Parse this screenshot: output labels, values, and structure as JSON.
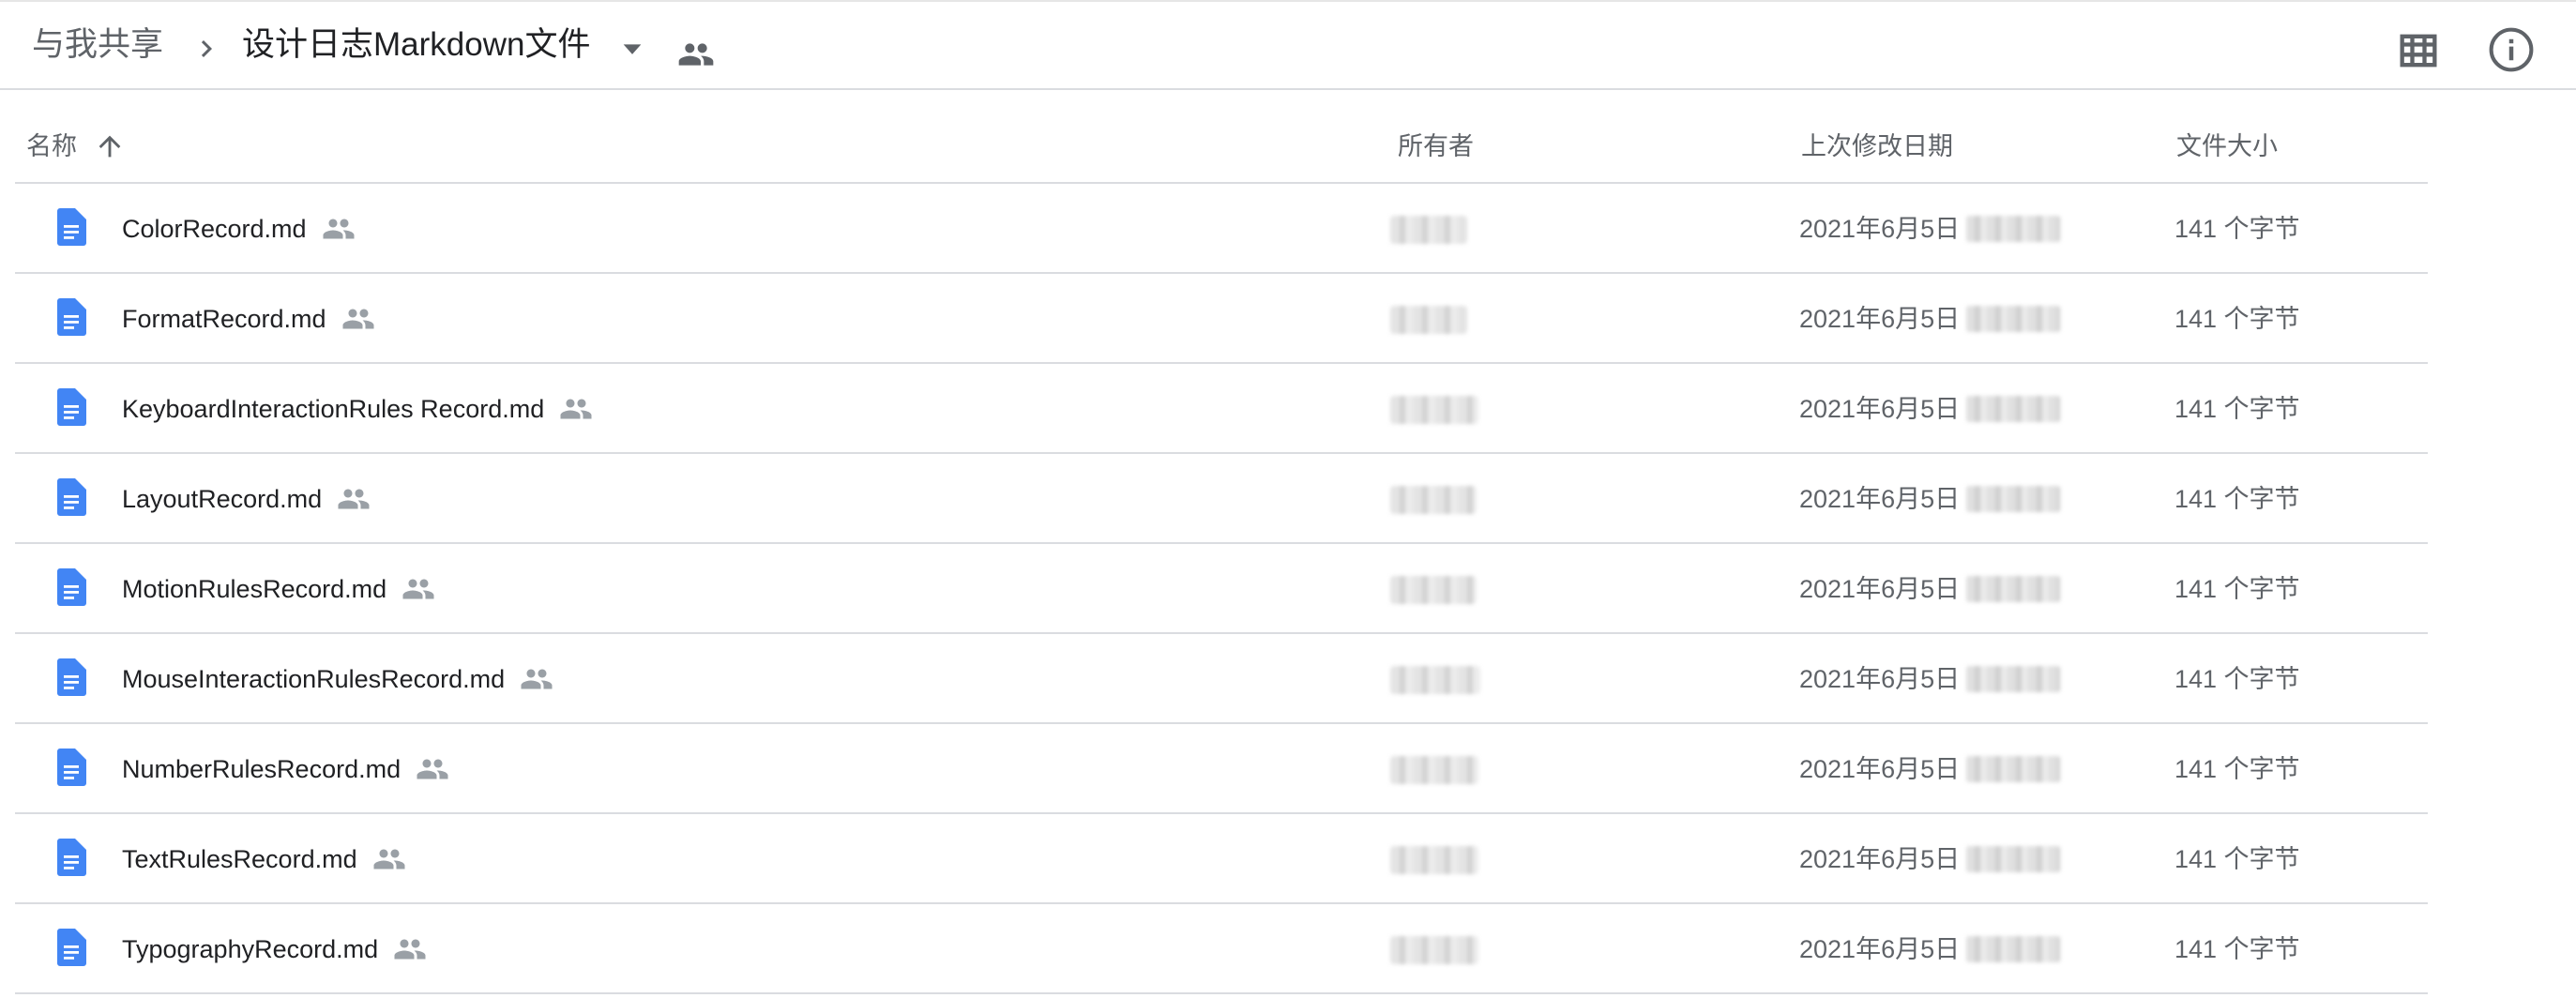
{
  "breadcrumb": {
    "root": "与我共享",
    "current": "设计日志Markdown文件"
  },
  "icons": {
    "chevron": "chevron-right-icon",
    "dropdown": "arrow-drop-down-icon",
    "shared": "people-icon",
    "grid": "grid-view-icon",
    "info": "info-icon",
    "doc": "google-docs-icon",
    "sort": "arrow-upward-icon"
  },
  "columns": {
    "name": "名称",
    "owner": "所有者",
    "modified": "上次修改日期",
    "size": "文件大小"
  },
  "colors": {
    "doc_blue": "#4285f4",
    "text_primary": "#202124",
    "text_secondary": "#5f6368",
    "divider": "#dadce0"
  },
  "files": [
    {
      "name": "ColorRecord.md",
      "modified": "2021年6月5日",
      "size": "141 个字节"
    },
    {
      "name": "FormatRecord.md",
      "modified": "2021年6月5日",
      "size": "141 个字节"
    },
    {
      "name": "KeyboardInteractionRules Record.md",
      "modified": "2021年6月5日",
      "size": "141 个字节"
    },
    {
      "name": "LayoutRecord.md",
      "modified": "2021年6月5日",
      "size": "141 个字节"
    },
    {
      "name": "MotionRulesRecord.md",
      "modified": "2021年6月5日",
      "size": "141 个字节"
    },
    {
      "name": "MouseInteractionRulesRecord.md",
      "modified": "2021年6月5日",
      "size": "141 个字节"
    },
    {
      "name": "NumberRulesRecord.md",
      "modified": "2021年6月5日",
      "size": "141 个字节"
    },
    {
      "name": "TextRulesRecord.md",
      "modified": "2021年6月5日",
      "size": "141 个字节"
    },
    {
      "name": "TypographyRecord.md",
      "modified": "2021年6月5日",
      "size": "141 个字节"
    }
  ]
}
